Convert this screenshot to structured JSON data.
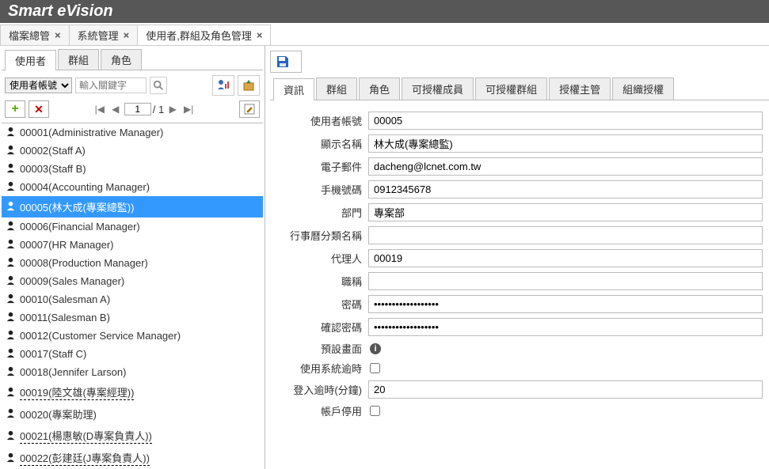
{
  "app_title": "Smart eVision",
  "main_tabs": [
    {
      "label": "檔案總管",
      "closable": true
    },
    {
      "label": "系統管理",
      "closable": true
    },
    {
      "label": "使用者,群組及角色管理",
      "closable": true,
      "active": true
    }
  ],
  "sub_tabs": [
    {
      "label": "使用者",
      "active": true
    },
    {
      "label": "群組"
    },
    {
      "label": "角色"
    }
  ],
  "search": {
    "field_select": "使用者帳號",
    "placeholder": "輸入關鍵字"
  },
  "pager": {
    "page": "1",
    "total": "1"
  },
  "users": [
    {
      "label": "00001(Administrative Manager)"
    },
    {
      "label": "00002(Staff A)"
    },
    {
      "label": "00003(Staff B)"
    },
    {
      "label": "00004(Accounting Manager)"
    },
    {
      "label": "00005(林大成(專案總監))",
      "selected": true
    },
    {
      "label": "00006(Financial Manager)"
    },
    {
      "label": "00007(HR Manager)"
    },
    {
      "label": "00008(Production Manager)"
    },
    {
      "label": "00009(Sales Manager)"
    },
    {
      "label": "00010(Salesman A)"
    },
    {
      "label": "00011(Salesman B)"
    },
    {
      "label": "00012(Customer Service Manager)"
    },
    {
      "label": "00017(Staff C)"
    },
    {
      "label": "00018(Jennifer Larson)"
    },
    {
      "label": "00019(陸文雄(專案經理))",
      "underline": true
    },
    {
      "label": "00020(專案助理)"
    },
    {
      "label": "00021(楊惠敏(D專案負責人))",
      "underline": true
    },
    {
      "label": "00022(彭建廷(J專案負責人))",
      "underline": true
    }
  ],
  "detail_tabs": [
    {
      "label": "資訊",
      "active": true
    },
    {
      "label": "群組"
    },
    {
      "label": "角色"
    },
    {
      "label": "可授權成員"
    },
    {
      "label": "可授權群組"
    },
    {
      "label": "授權主管"
    },
    {
      "label": "組織授權"
    }
  ],
  "form": {
    "labels": {
      "account": "使用者帳號",
      "display": "顯示名稱",
      "email": "電子郵件",
      "mobile": "手機號碼",
      "dept": "部門",
      "calendar": "行事曆分類名稱",
      "agent": "代理人",
      "title": "職稱",
      "pwd": "密碼",
      "pwd2": "確認密碼",
      "default_page": "預設畫面",
      "system_timeout": "使用系統逾時",
      "login_timeout": "登入逾時(分鐘)",
      "disable": "帳戶停用"
    },
    "values": {
      "account": "00005",
      "display": "林大成(專案總監)",
      "email": "dacheng@lcnet.com.tw",
      "mobile": "0912345678",
      "dept": "專案部",
      "calendar": "",
      "agent": "00019",
      "title": "",
      "pwd": "••••••••••••••••••",
      "pwd2": "••••••••••••••••••",
      "login_timeout": "20"
    }
  }
}
